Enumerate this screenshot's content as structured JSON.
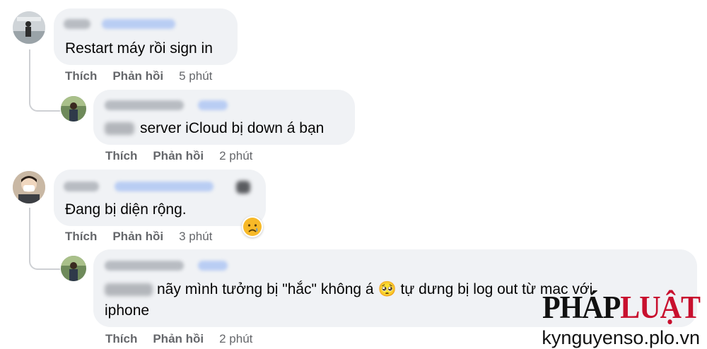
{
  "comments": [
    {
      "id": "c1",
      "text": "Restart máy rồi sign in",
      "actions": {
        "like": "Thích",
        "reply": "Phản hồi",
        "time": "5 phút"
      },
      "replies": [
        {
          "id": "c1r1",
          "text": "server iCloud bị down á bạn",
          "actions": {
            "like": "Thích",
            "reply": "Phản hồi",
            "time": "2 phút"
          }
        }
      ]
    },
    {
      "id": "c2",
      "text": "Đang bị diện rộng.",
      "reaction": "crying-emoji",
      "actions": {
        "like": "Thích",
        "reply": "Phản hồi",
        "time": "3 phút"
      },
      "replies": [
        {
          "id": "c2r1",
          "text_part1": "nãy mình tưởng bị \"hắc\" không á",
          "emoji": "🥺",
          "text_part2": "tự dưng bị log out từ mac với",
          "text_line2": "iphone",
          "actions": {
            "like": "Thích",
            "reply": "Phản hồi",
            "time": "2 phút"
          }
        }
      ]
    }
  ],
  "watermark": {
    "logo_part1": "PHÁP",
    "logo_part2": "LUẬT",
    "url": "kynguyenso.plo.vn"
  },
  "colors": {
    "bubble": "#f0f2f5",
    "meta_text": "#65676b",
    "name_blur": "#b8bcc2",
    "tag_blur": "#b9cdf3",
    "brand_red": "#c8102e"
  }
}
